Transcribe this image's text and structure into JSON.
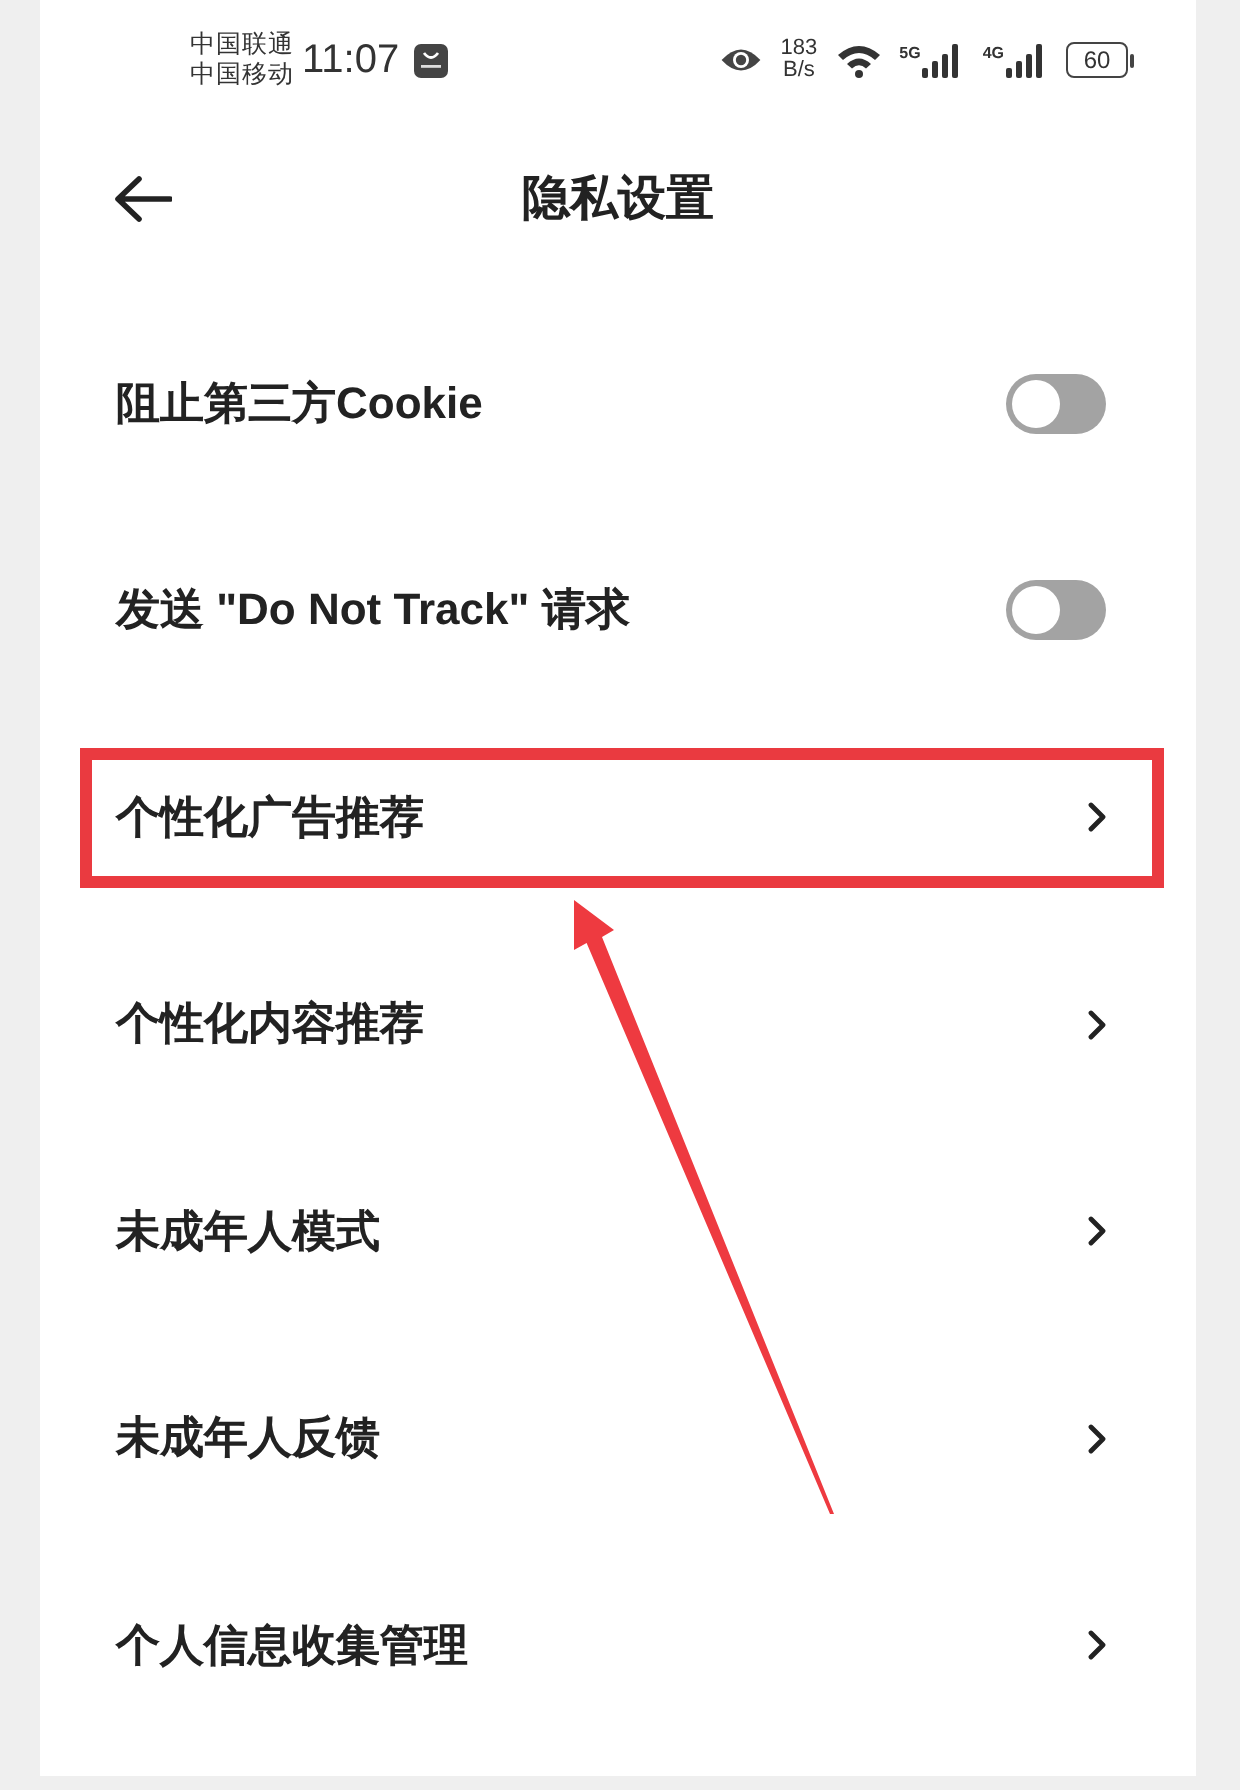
{
  "status_bar": {
    "carriers": [
      "中国联通",
      "中国移动"
    ],
    "time": "11:07",
    "net_speed": {
      "value": "183",
      "unit": "B/s"
    },
    "signals": [
      {
        "network": "5G"
      },
      {
        "network": "4G"
      }
    ],
    "battery": "60"
  },
  "header": {
    "title": "隐私设置"
  },
  "rows": [
    {
      "kind": "toggle",
      "label": "阻止第三方Cookie",
      "on": false,
      "highlighted": false
    },
    {
      "kind": "toggle",
      "label": "发送 \"Do Not Track\" 请求",
      "on": false,
      "highlighted": false
    },
    {
      "kind": "link",
      "label": "个性化广告推荐",
      "highlighted": true
    },
    {
      "kind": "link",
      "label": "个性化内容推荐",
      "highlighted": false
    },
    {
      "kind": "link",
      "label": "未成年人模式",
      "highlighted": false
    },
    {
      "kind": "link",
      "label": "未成年人反馈",
      "highlighted": false
    },
    {
      "kind": "link",
      "label": "个人信息收集管理",
      "highlighted": false
    }
  ]
}
